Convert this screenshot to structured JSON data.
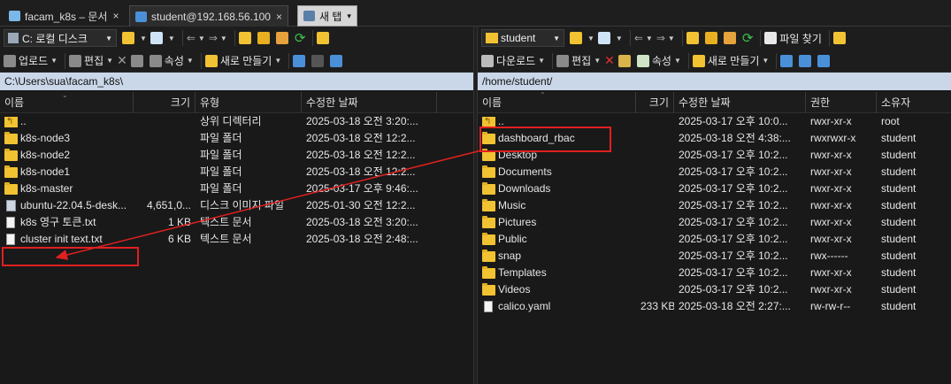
{
  "tabs": [
    {
      "label": "facam_k8s – 문서",
      "close": "×"
    },
    {
      "label": "student@192.168.56.100",
      "close": "×"
    },
    {
      "label": "새 탭",
      "dropdown": "▾"
    }
  ],
  "left": {
    "drive_combo": "C: 로컬 디스크",
    "toolbar2": {
      "upload": "업로드",
      "edit": "편집",
      "properties": "속성",
      "new": "새로 만들기"
    },
    "path": "C:\\Users\\sua\\facam_k8s\\",
    "columns": [
      "이름",
      "크기",
      "유형",
      "수정한 날짜"
    ],
    "rows": [
      {
        "name": "..",
        "size": "",
        "type": "상위 디렉터리",
        "date": "2025-03-18 오전 3:20:...",
        "icon": "upfolder"
      },
      {
        "name": "k8s-node3",
        "size": "",
        "type": "파일 폴더",
        "date": "2025-03-18 오전 12:2...",
        "icon": "folder"
      },
      {
        "name": "k8s-node2",
        "size": "",
        "type": "파일 폴더",
        "date": "2025-03-18 오전 12:2...",
        "icon": "folder"
      },
      {
        "name": "k8s-node1",
        "size": "",
        "type": "파일 폴더",
        "date": "2025-03-18 오전 12:2...",
        "icon": "folder"
      },
      {
        "name": "k8s-master",
        "size": "",
        "type": "파일 폴더",
        "date": "2025-03-17 오후 9:46:...",
        "icon": "folder"
      },
      {
        "name": "ubuntu-22.04.5-desk...",
        "size": "4,651,0...",
        "type": "디스크 이미지 파일",
        "date": "2025-01-30 오전 12:2...",
        "icon": "disk"
      },
      {
        "name": "k8s 영구 토큰.txt",
        "size": "1 KB",
        "type": "텍스트 문서",
        "date": "2025-03-18 오전 3:20:...",
        "icon": "file"
      },
      {
        "name": "cluster init text.txt",
        "size": "6 KB",
        "type": "텍스트 문서",
        "date": "2025-03-18 오전 2:48:...",
        "icon": "file"
      }
    ]
  },
  "right": {
    "dir_combo": "student",
    "toolbar1": {
      "find": "파일 찾기"
    },
    "toolbar2": {
      "download": "다운로드",
      "edit": "편집",
      "properties": "속성",
      "new": "새로 만들기"
    },
    "path": "/home/student/",
    "columns": [
      "이름",
      "크기",
      "수정한 날짜",
      "권한",
      "소유자"
    ],
    "rows": [
      {
        "name": "..",
        "size": "",
        "date": "2025-03-17 오후 10:0...",
        "perm": "rwxr-xr-x",
        "owner": "root",
        "icon": "upfolder"
      },
      {
        "name": "dashboard_rbac",
        "size": "",
        "date": "2025-03-18 오전 4:38:...",
        "perm": "rwxrwxr-x",
        "owner": "student",
        "icon": "folder"
      },
      {
        "name": "Desktop",
        "size": "",
        "date": "2025-03-17 오후 10:2...",
        "perm": "rwxr-xr-x",
        "owner": "student",
        "icon": "folder"
      },
      {
        "name": "Documents",
        "size": "",
        "date": "2025-03-17 오후 10:2...",
        "perm": "rwxr-xr-x",
        "owner": "student",
        "icon": "folder"
      },
      {
        "name": "Downloads",
        "size": "",
        "date": "2025-03-17 오후 10:2...",
        "perm": "rwxr-xr-x",
        "owner": "student",
        "icon": "folder"
      },
      {
        "name": "Music",
        "size": "",
        "date": "2025-03-17 오후 10:2...",
        "perm": "rwxr-xr-x",
        "owner": "student",
        "icon": "folder"
      },
      {
        "name": "Pictures",
        "size": "",
        "date": "2025-03-17 오후 10:2...",
        "perm": "rwxr-xr-x",
        "owner": "student",
        "icon": "folder"
      },
      {
        "name": "Public",
        "size": "",
        "date": "2025-03-17 오후 10:2...",
        "perm": "rwxr-xr-x",
        "owner": "student",
        "icon": "folder"
      },
      {
        "name": "snap",
        "size": "",
        "date": "2025-03-17 오후 10:2...",
        "perm": "rwx------",
        "owner": "student",
        "icon": "folder"
      },
      {
        "name": "Templates",
        "size": "",
        "date": "2025-03-17 오후 10:2...",
        "perm": "rwxr-xr-x",
        "owner": "student",
        "icon": "folder"
      },
      {
        "name": "Videos",
        "size": "",
        "date": "2025-03-17 오후 10:2...",
        "perm": "rwxr-xr-x",
        "owner": "student",
        "icon": "folder"
      },
      {
        "name": "calico.yaml",
        "size": "233 KB",
        "date": "2025-03-18 오전 2:27:...",
        "perm": "rw-rw-r--",
        "owner": "student",
        "icon": "file"
      }
    ]
  },
  "colors": {
    "highlight": "#e02020",
    "path_bg": "#c9d7e8",
    "folder": "#f1c232"
  }
}
